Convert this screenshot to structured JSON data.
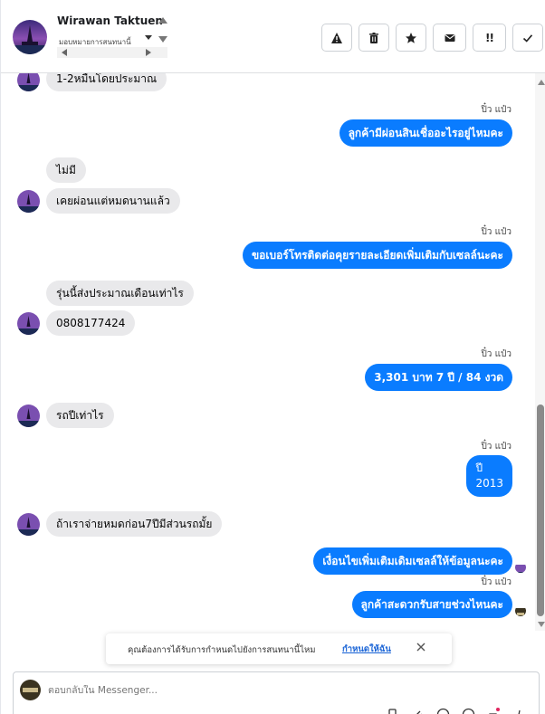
{
  "header": {
    "name": "Wirawan Taktuen",
    "assign_label": "มอบหมายการสนทนานี้",
    "tools": {
      "spam": "spam-icon",
      "delete": "trash-icon",
      "star": "star-icon",
      "mail": "envelope-icon",
      "important_label": "!!",
      "done": "check-icon"
    }
  },
  "messages": {
    "in_1": "1-2หมื่นโดยประมาณ",
    "sender_1": "ปิ๋ว แป๋ว",
    "out_1": "ลูกค้ามีผ่อนสินเชื่ออะไรอยู่ไหมคะ",
    "in_2": "ไม่มี",
    "in_3": "เคยผ่อนแต่หมดนานแล้ว",
    "sender_2": "ปิ๋ว แป๋ว",
    "out_2": "ขอเบอร์โทรติดต่อคุยรายละเอียดเพิ่มเติมกับเซลล์นะคะ",
    "in_4": "รุ่นนี้ส่งประมาณเดือนเท่าไร",
    "in_5": "0808177424",
    "sender_3": "ปิ๋ว แป๋ว",
    "out_3": "3,301 บาท  7 ปี / 84 งวด",
    "in_6": "รถปีเท่าไร",
    "sender_4": "ปิ๋ว แป๋ว",
    "out_4_line1": "ปี",
    "out_4_line2": "2013",
    "in_7": "ถ้าเราจ่ายหมดก่อน7ปีมีส่วนรถมั้ย",
    "out_5": "เงื่อนไขเพิ่มเติมเดิมเซลล์ให้ข้อมูลนะคะ",
    "sender_5": "ปิ๋ว แป๋ว",
    "out_6": "ลูกค้าสะดวกรับสายช่วงไหนคะ"
  },
  "banner": {
    "text": "คุณต้องการได้รับการกำหนดไปยังการสนทนานี้ไหม",
    "link": "กำหนดให้ฉัน"
  },
  "composer": {
    "placeholder": "ตอบกลับใน Messenger..."
  },
  "colors": {
    "outgoing_bubble": "#0a7cff",
    "incoming_bubble": "#e9e9eb",
    "link": "#1a64d6"
  }
}
